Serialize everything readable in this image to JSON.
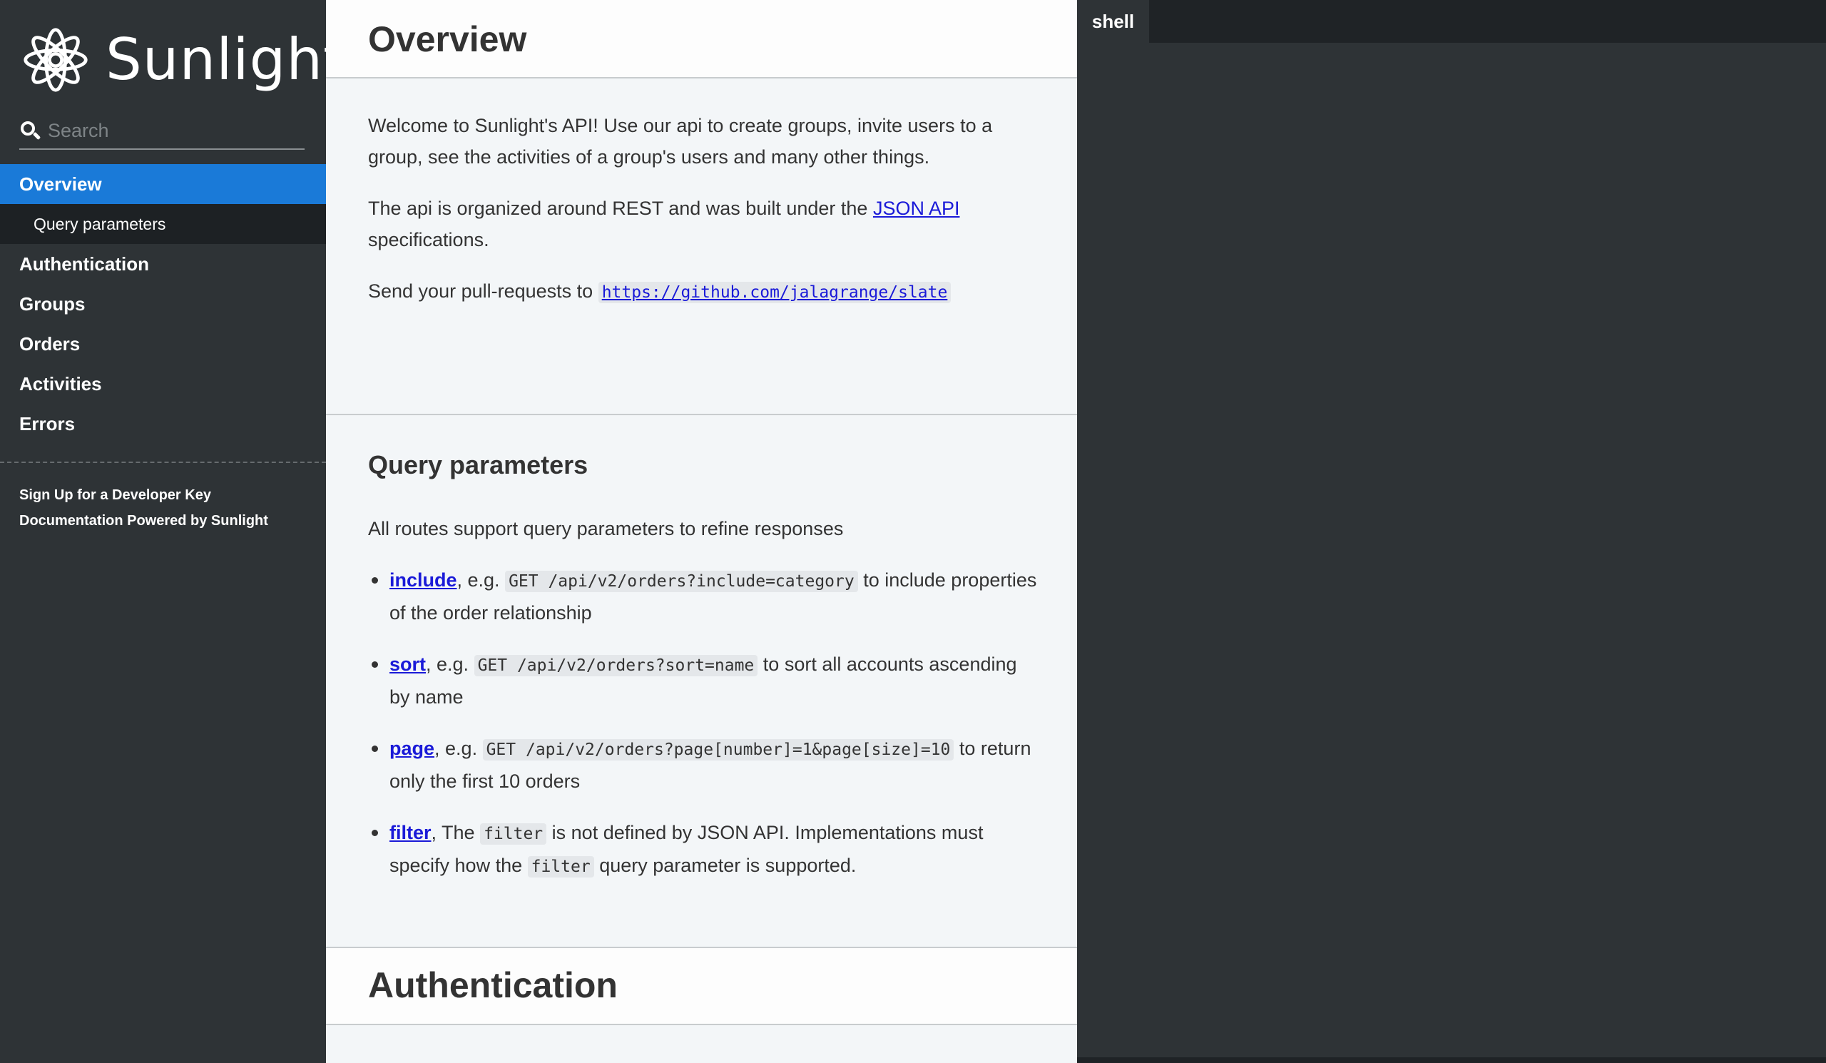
{
  "sidebar": {
    "logo_text": "Sunlight",
    "search_placeholder": "Search",
    "nav": [
      {
        "label": "Overview"
      },
      {
        "label": "Query parameters"
      },
      {
        "label": "Authentication"
      },
      {
        "label": "Groups"
      },
      {
        "label": "Orders"
      },
      {
        "label": "Activities"
      },
      {
        "label": "Errors"
      }
    ],
    "footer": [
      {
        "label": "Sign Up for a Developer Key"
      },
      {
        "label": "Documentation Powered by Sunlight"
      }
    ]
  },
  "main": {
    "overview_title": "Overview",
    "p1": "Welcome to Sunlight's API! Use our api to create groups, invite users to a group, see the activities of a group's users and many other things.",
    "p2_before": "The api is organized around REST and was built under the ",
    "p2_link": "JSON API",
    "p2_after": " specifications.",
    "p3_before": "Send your pull-requests to ",
    "p3_link": "https://github.com/jalagrange/slate",
    "query_title": "Query parameters",
    "query_intro": "All routes support query parameters to refine responses",
    "query_items": [
      {
        "name": "include",
        "sep": ", e.g. ",
        "code": "GET /api/v2/orders?include=category",
        "desc": " to include properties of the order relationship"
      },
      {
        "name": "sort",
        "sep": ", e.g. ",
        "code": "GET /api/v2/orders?sort=name",
        "desc": " to sort all accounts ascending by name"
      },
      {
        "name": "page",
        "sep": ", e.g. ",
        "code": "GET /api/v2/orders?page[number]=1&page[size]=10",
        "desc": " to return only the first 10 orders"
      }
    ],
    "filter_item": {
      "name": "filter",
      "t1": ", The ",
      "code1": "filter",
      "t2": " is not defined by JSON API. Implementations must specify how the ",
      "code2": "filter",
      "t3": " query parameter is supported."
    },
    "auth_title": "Authentication"
  },
  "shell": {
    "tab_label": "shell"
  },
  "colors": {
    "sidebar_bg": "#2e3336",
    "active_nav": "#1a7ad8",
    "content_bg": "#f3f6f8",
    "link": "#1a1ad8"
  }
}
